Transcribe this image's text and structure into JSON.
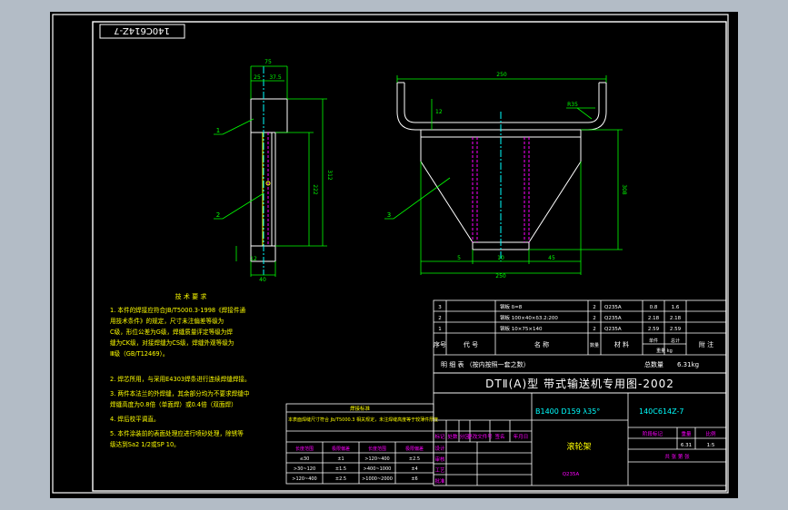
{
  "drawing": {
    "code_rotated": "140C614Z-7",
    "code": "140C614Z-7",
    "title_bar": "DTⅡ(A)型 带式输送机专用图-2002",
    "spec": "B1400 D159 λ35°",
    "part_name": "滚轮架",
    "total_mass": "6.31kg",
    "unit_label": "总数量",
    "material_note": "Q235A"
  },
  "tech_requirements": {
    "title": "技 术 要 求",
    "lines": [
      "1. 本件的焊接应符合JB/T5000.3-1998《焊接件通",
      "   用技术条件》的规定，尺寸未注偏差等级为",
      "   C级，形位公差为G级，焊缝质量评定等级为焊",
      "   缝为CK级，对接焊缝为CS级，焊缝外观等级为",
      "   Ⅲ级（GB/T12469）。",
      "2. 焊芯所用，与采用E4303焊条进行连续焊缝焊接。",
      "3. 两件本法兰的外焊缝，其余部分均为不要求焊缝中",
      "   焊缝高度为0.8倍（单面焊）或0.4倍（双面焊）",
      "4. 焊后校平调直。",
      "5. 本件涂装前的表面处理应进行喷砂处理，除锈等",
      "   级达到Sa2 1/2或SP 10。"
    ]
  },
  "small_table": {
    "title": "焊接标准",
    "note": "本表面焊缝尺寸符合 Jb/T5000.3 相关规定，未注焊缝高度等于较薄件厚度",
    "header": [
      "长度范围",
      "极限偏差",
      "长度范围",
      "极限偏差"
    ],
    "rows": [
      [
        "≤30",
        "±1",
        ">120~400",
        "±2.5"
      ],
      [
        ">30~120",
        "±1.5",
        ">400~1000",
        "±4"
      ],
      [
        ">120~400",
        "±2.5",
        ">1000~2000",
        "±6"
      ],
      [
        ">400~1000",
        "±4",
        ">2000~4000",
        "±8"
      ]
    ]
  },
  "bom": {
    "rows": [
      {
        "no": "3",
        "code": "",
        "name": "钢板 δ=8",
        "qty": "2",
        "material": "Q235A",
        "unit": "0.8",
        "total": "1.6"
      },
      {
        "no": "2",
        "code": "",
        "name": "钢板 100×40×δ3.2:200",
        "qty": "2",
        "material": "Q235A",
        "unit": "2.18",
        "total": "2.18"
      },
      {
        "no": "1",
        "code": "",
        "name": "钢板 10×75×140",
        "qty": "2",
        "material": "Q235A",
        "unit": "2.59",
        "total": "2.59"
      }
    ],
    "header": {
      "no": "序号",
      "code": "代 号",
      "name": "名 称",
      "qty": "数量",
      "material": "材 料",
      "unit": "单件",
      "total": "总计",
      "weight": "重量 kg",
      "remark": "附 注"
    },
    "detail_label": "明 细 表 （按内按照一套之数）"
  },
  "title_block": {
    "labels": [
      "标记",
      "处数",
      "分区",
      "更改文件号",
      "签名",
      "年月日"
    ],
    "row_labels": [
      "设计",
      "审核",
      "工艺",
      "批准"
    ],
    "stage_label": "阶段标记",
    "weight_label": "重量",
    "scale_label": "比例",
    "weight": "6.31",
    "scale": "1:5",
    "sheet_label": "共 张 第 张"
  },
  "dimensions": {
    "side_top": "75",
    "side_sub1": "25",
    "side_sub2": "37.5",
    "side_h1": "312",
    "side_h2": "222",
    "side_b1": "12",
    "side_b2": "40",
    "front_top": "250",
    "front_r": "R35",
    "front_h": "308",
    "front_l": "5",
    "front_m": "10",
    "front_rr": "45",
    "front_w": "250"
  },
  "leaders": [
    "1",
    "2",
    "3"
  ]
}
